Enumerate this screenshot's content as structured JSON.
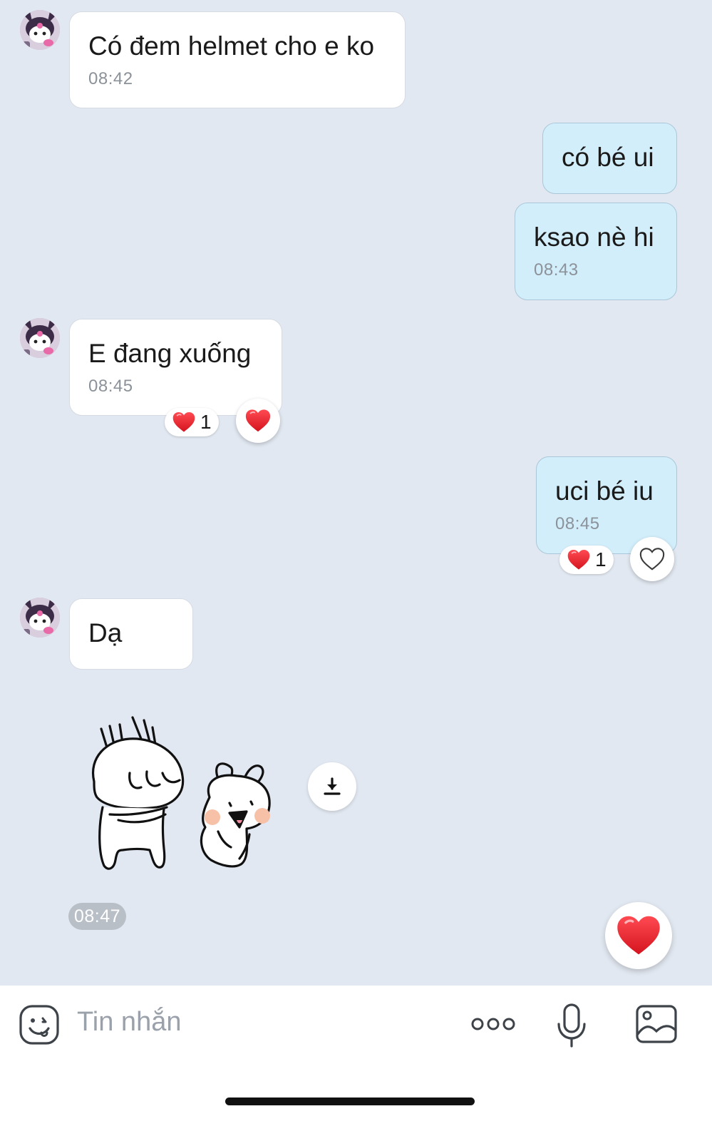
{
  "messages": [
    {
      "text": "Có đem helmet cho e ko",
      "time": "08:42"
    },
    {
      "text": "có bé ui"
    },
    {
      "text": "ksao nè hi",
      "time": "08:43"
    },
    {
      "text": "E đang xuống",
      "time": "08:45",
      "reaction_count": "1"
    },
    {
      "text": "uci bé iu",
      "time": "08:45",
      "reaction_count": "1"
    },
    {
      "text": "Dạ"
    }
  ],
  "sticker": {
    "time": "08:47"
  },
  "composer": {
    "placeholder": "Tin nhắn"
  },
  "colors": {
    "background": "#e2e8f1",
    "incoming_bubble": "#ffffff",
    "outgoing_bubble": "#d3eefb",
    "heart": "#e8202a"
  },
  "icons": [
    "avatar",
    "heart-icon",
    "heart-outline-icon",
    "download-icon",
    "emoji-icon",
    "more-icon",
    "mic-icon",
    "image-icon"
  ]
}
